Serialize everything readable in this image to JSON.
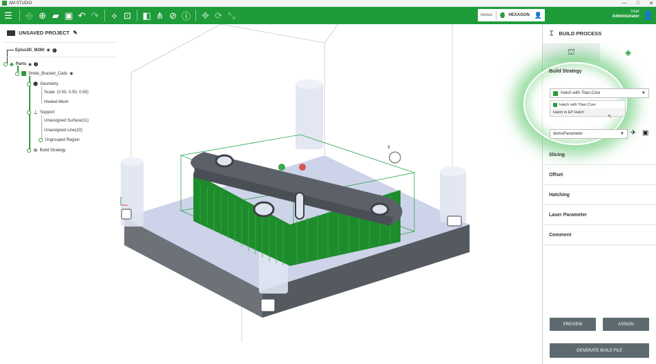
{
  "app": {
    "title": "AM STUDIO"
  },
  "window_controls": {
    "minimize": "—",
    "maximize": "□",
    "close": "✕"
  },
  "toolbar": {
    "menu_icon": "hamburger-icon",
    "tools": [
      "add-part-icon",
      "add-icon",
      "open-folder-icon",
      "save-icon",
      "undo-icon",
      "redo-icon",
      "arrange-icon",
      "auto-place-icon",
      "build-plate-icon",
      "support-icon",
      "slice-icon",
      "info-icon",
      "move-icon",
      "rotate-icon",
      "scale-icon"
    ],
    "brand": {
      "left": "nexus",
      "right": "HEXAGON"
    },
    "user": {
      "role": "User",
      "name": "Administrator"
    }
  },
  "project": {
    "title": "UNSAVED PROJECT",
    "machine": "Eplus3D_M260",
    "parts_label": "Parts",
    "part_name": "3Hole_Bracket_Cads",
    "geometry_label": "Geometry",
    "scale_label": "Scale: (0.50, 0.50, 0.50)",
    "healed_label": "Healed Mesh",
    "support_label": "Support",
    "unassigned_surface": "Unassigned Surface(11)",
    "unassigned_line": "Unassigned Line(10)",
    "ungrouped_region": "Ungrouped Region",
    "build_strategy": "Build Strategy"
  },
  "right_panel": {
    "title": "BUILD PROCESS",
    "build_strategy_title": "Build Strategy",
    "strategy_selected": "Hatch with Titan.Core",
    "strategy_options": [
      "Hatch with Titan.Core",
      "Hatch in EP Hatch"
    ],
    "parameter_value": "demoParameter",
    "sections": [
      "Slicing",
      "Offset",
      "Hatching",
      "Laser Parameter",
      "Comment"
    ],
    "preview_label": "PREVIEW",
    "assign_label": "ASSIGN",
    "generate_label": "GENERATE BUILD FILE"
  },
  "colors": {
    "accent": "#1f9c3a",
    "button": "#5d6b70",
    "plate": "#cbd2e6"
  }
}
